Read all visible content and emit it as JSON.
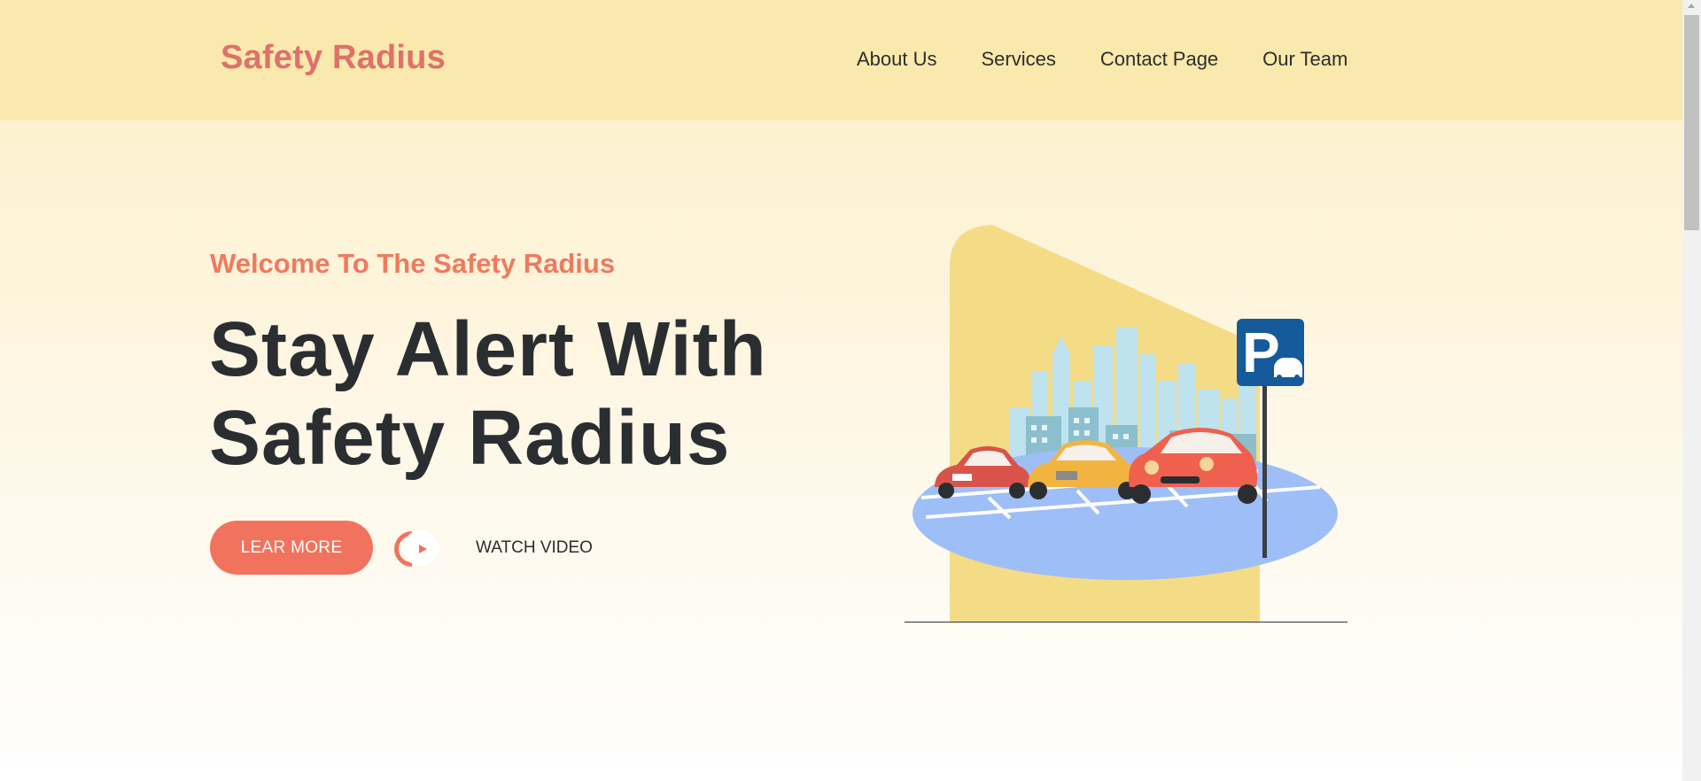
{
  "header": {
    "logo": "Safety Radius",
    "nav": [
      {
        "label": "About Us"
      },
      {
        "label": "Services"
      },
      {
        "label": "Contact Page"
      },
      {
        "label": "Our Team"
      }
    ]
  },
  "hero": {
    "welcome": "Welcome To The Safety Radius",
    "headline_line1": "Stay Alert With",
    "headline_line2": "Safety Radius",
    "learn_more_label": "LEAR MORE",
    "watch_video_label": "WATCH VIDEO"
  },
  "illustration": {
    "sign_letter": "P",
    "icons": [
      "parking-sign-icon",
      "car-icon",
      "city-skyline-icon"
    ]
  },
  "colors": {
    "header_bg": "#f9e9ad",
    "accent": "#f1735e",
    "logo": "#e0706b",
    "text_dark": "#2b2e31",
    "illustration_bg": "#f4dc86",
    "parking_lot": "#9ebef7",
    "sign_blue": "#155a9a"
  }
}
